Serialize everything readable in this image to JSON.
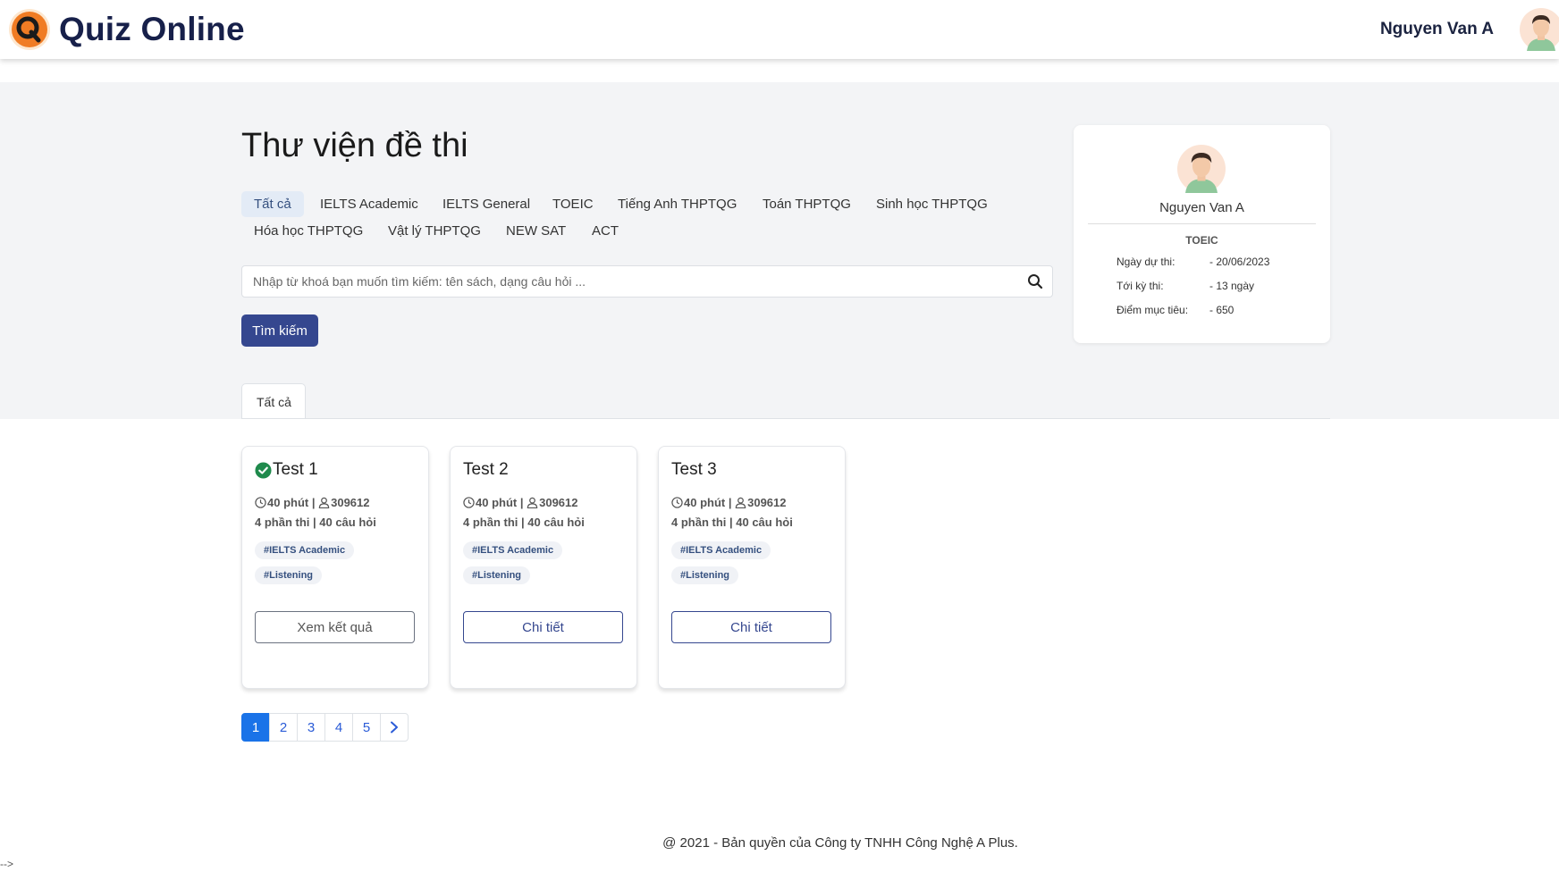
{
  "header": {
    "brand": "Quiz Online",
    "user_name": "Nguyen Van A"
  },
  "page_title": "Thư viện đề thi",
  "categories": [
    "Tất cả",
    "IELTS Academic",
    "IELTS General",
    "TOEIC",
    "Tiếng Anh THPTQG",
    "Toán THPTQG",
    "Sinh học THPTQG",
    "Hóa học THPTQG",
    "Vật lý THPTQG",
    "NEW SAT",
    "ACT"
  ],
  "search": {
    "placeholder": "Nhập từ khoá bạn muốn tìm kiếm: tên sách, dạng câu hỏi ...",
    "button_label": "Tìm kiếm"
  },
  "tab_label": "Tất cả",
  "profile": {
    "name": "Nguyen Van A",
    "exam": "TOEIC",
    "rows": [
      {
        "label": "Ngày dự thi:",
        "value": "- 20/06/2023"
      },
      {
        "label": "Tới kỳ thi:",
        "value": "- 13 ngày"
      },
      {
        "label": "Điểm mục tiêu:",
        "value": "- 650"
      }
    ]
  },
  "tests": [
    {
      "title": "Test 1",
      "done": true,
      "duration": "40 phút |",
      "participants": "309612",
      "parts": "4 phần thi | 40 câu hỏi",
      "tags": [
        "#IELTS Academic",
        "#Listening"
      ],
      "button": "Xem kết quả"
    },
    {
      "title": "Test 2",
      "done": false,
      "duration": "40 phút |",
      "participants": "309612",
      "parts": "4 phần thi | 40 câu hỏi",
      "tags": [
        "#IELTS Academic",
        "#Listening"
      ],
      "button": "Chi tiết"
    },
    {
      "title": "Test 3",
      "done": false,
      "duration": "40 phút |",
      "participants": "309612",
      "parts": "4 phần thi | 40 câu hỏi",
      "tags": [
        "#IELTS Academic",
        "#Listening"
      ],
      "button": "Chi tiết"
    }
  ],
  "pagination": {
    "pages": [
      "1",
      "2",
      "3",
      "4",
      "5"
    ],
    "current": "1",
    "next_icon": "chevron-right-icon"
  },
  "footer": "@ 2021 - Bản quyền của Công ty TNHH Công Nghệ A Plus.",
  "stray_text": "-->",
  "colors": {
    "primary": "#35478f",
    "brand_text": "#17204a",
    "band": "#f3f4f6",
    "active_page": "#1a73e8",
    "check": "#1f8a4c",
    "logo": "#f07c24"
  }
}
